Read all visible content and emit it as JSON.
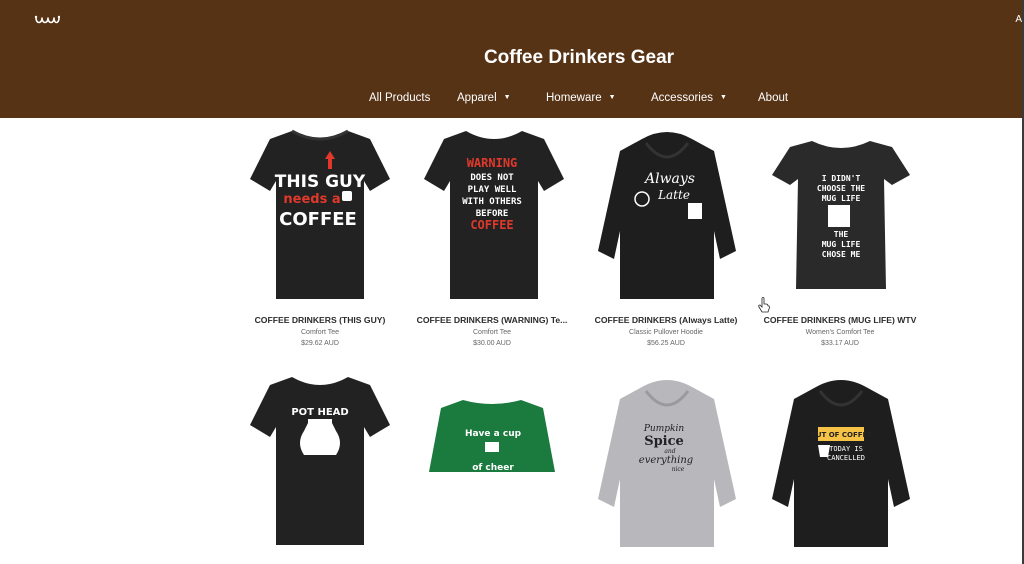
{
  "header": {
    "title": "Coffee Drinkers Gear",
    "top_right": "A",
    "logo_icon": "logo-icon",
    "bg_color": "#573316"
  },
  "nav": {
    "items": [
      {
        "label": "All Products",
        "dropdown": false
      },
      {
        "label": "Apparel",
        "dropdown": true
      },
      {
        "label": "Homeware",
        "dropdown": true
      },
      {
        "label": "Accessories",
        "dropdown": true
      },
      {
        "label": "About",
        "dropdown": false
      }
    ]
  },
  "products": [
    {
      "name": "COFFEE DRINKERS (THIS GUY)",
      "type": "Comfort Tee",
      "price": "$29.62 AUD",
      "art": [
        "THIS GUY",
        "needs a",
        "COFFEE"
      ]
    },
    {
      "name": "COFFEE DRINKERS (WARNING) Te...",
      "type": "Comfort Tee",
      "price": "$30.00 AUD",
      "art": [
        "WARNING",
        "DOES NOT",
        "PLAY WELL",
        "WITH OTHERS",
        "BEFORE",
        "COFFEE"
      ]
    },
    {
      "name": "COFFEE DRINKERS (Always Latte)",
      "type": "Classic Pullover Hoodie",
      "price": "$56.25 AUD",
      "art": [
        "Always",
        "Latte"
      ]
    },
    {
      "name": "COFFEE DRINKERS (MUG LIFE) WTV",
      "type": "Women's Comfort Tee",
      "price": "$33.17 AUD",
      "art": [
        "I DIDN'T",
        "CHOOSE THE",
        "MUG LIFE",
        "THE",
        "MUG LIFE",
        "CHOSE ME"
      ]
    },
    {
      "art": [
        "POT HEAD"
      ]
    },
    {
      "art": [
        "Have a cup",
        "of cheer"
      ]
    },
    {
      "art": [
        "Pumpkin",
        "Spice",
        "and",
        "everything",
        "nice"
      ]
    },
    {
      "art": [
        "OUT OF COFFEE",
        "TODAY IS",
        "CANCELLED"
      ]
    }
  ]
}
